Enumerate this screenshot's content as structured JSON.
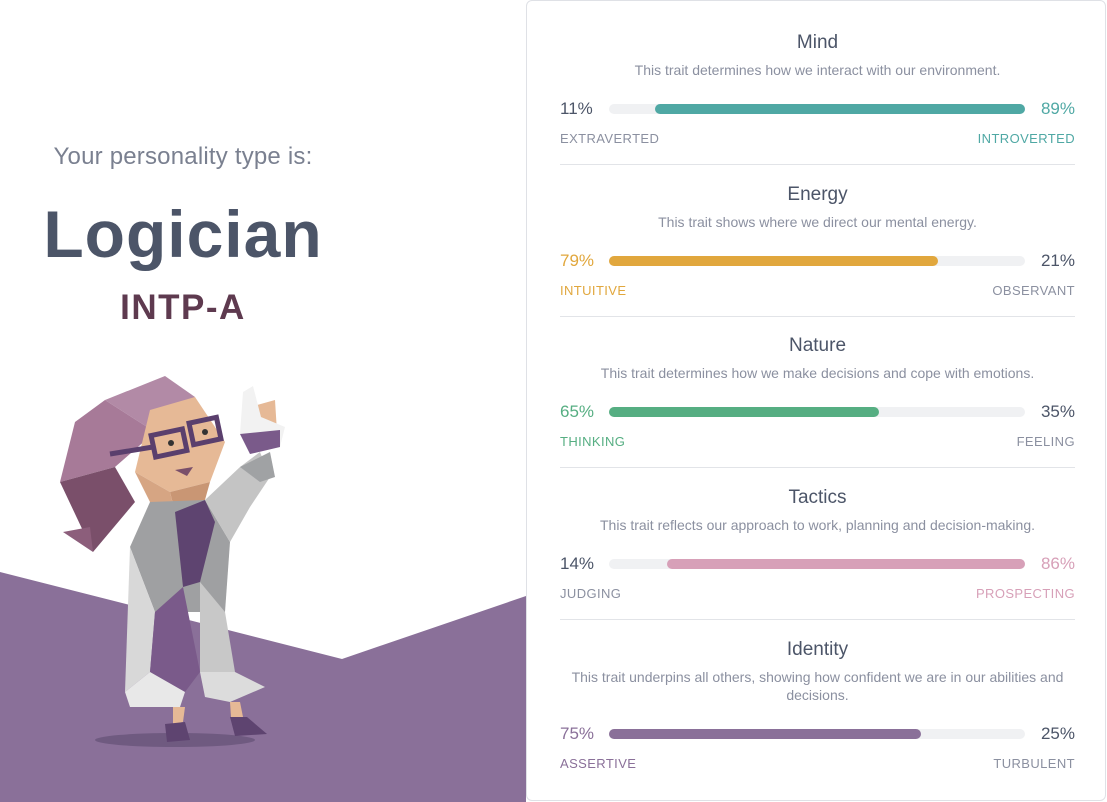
{
  "header": {
    "intro": "Your personality type is:",
    "type_name": "Logician",
    "type_code": "INTP-A"
  },
  "colors": {
    "hero_purple": "#8a7099",
    "mind": "#4fa8a4",
    "energy": "#e1a73d",
    "nature": "#56ae82",
    "tactics": "#d7a0b8",
    "identity": "#8a7099"
  },
  "traits": [
    {
      "title": "Mind",
      "description": "This trait determines how we interact with our environment.",
      "left_percent": "11%",
      "right_percent": "89%",
      "left_label": "EXTRAVERTED",
      "right_label": "INTROVERTED",
      "dominant": "right",
      "dominant_value": 89
    },
    {
      "title": "Energy",
      "description": "This trait shows where we direct our mental energy.",
      "left_percent": "79%",
      "right_percent": "21%",
      "left_label": "INTUITIVE",
      "right_label": "OBSERVANT",
      "dominant": "left",
      "dominant_value": 79
    },
    {
      "title": "Nature",
      "description": "This trait determines how we make decisions and cope with emotions.",
      "left_percent": "65%",
      "right_percent": "35%",
      "left_label": "THINKING",
      "right_label": "FEELING",
      "dominant": "left",
      "dominant_value": 65
    },
    {
      "title": "Tactics",
      "description": "This trait reflects our approach to work, planning and decision-making.",
      "left_percent": "14%",
      "right_percent": "86%",
      "left_label": "JUDGING",
      "right_label": "PROSPECTING",
      "dominant": "right",
      "dominant_value": 86
    },
    {
      "title": "Identity",
      "description": "This trait underpins all others, showing how confident we are in our abilities and decisions.",
      "left_percent": "75%",
      "right_percent": "25%",
      "left_label": "ASSERTIVE",
      "right_label": "TURBULENT",
      "dominant": "left",
      "dominant_value": 75
    }
  ]
}
